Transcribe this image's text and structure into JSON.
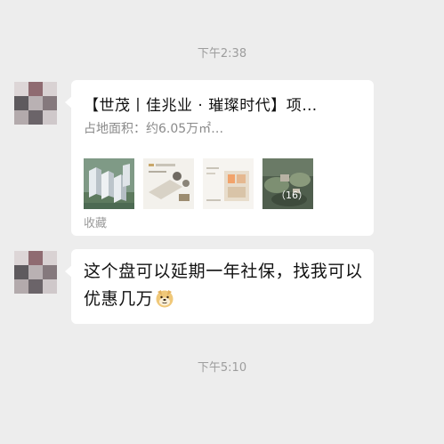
{
  "chat": {
    "timestamp_1": "下午2:38",
    "timestamp_2": "下午5:10"
  },
  "messages": [
    {
      "type": "link_card",
      "title": "【世茂丨佳兆业 · 璀璨时代】项…",
      "description": "占地面积：约6.05万㎡…",
      "thumbnail_count": "（16）",
      "footer": "收藏"
    },
    {
      "type": "text",
      "text": "这个盘可以延期一年社保，找我可以优惠几万",
      "emoji": "doge-emoji"
    }
  ],
  "colors": {
    "background": "#ededed",
    "bubble": "#ffffff",
    "timestamp": "#9d9d9d"
  }
}
